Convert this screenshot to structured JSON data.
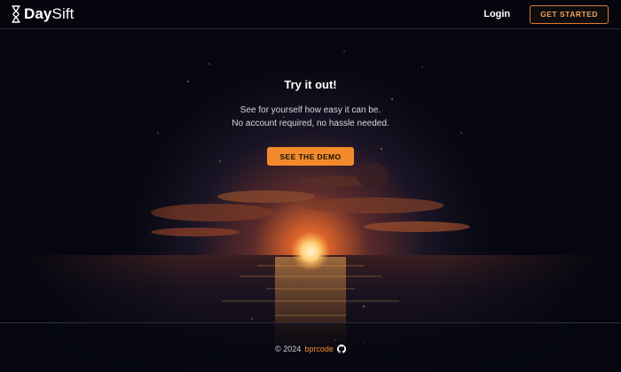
{
  "header": {
    "brand_bold": "Day",
    "brand_thin": "Sift",
    "login_label": "Login",
    "get_started_label": "GET STARTED"
  },
  "hero": {
    "title": "Try it out!",
    "line1": "See for yourself how easy it can be.",
    "line2": "No account required, no hassle needed.",
    "demo_label": "SEE THE DEMO"
  },
  "footer": {
    "copyright": "© 2024",
    "author_link": "bprcode",
    "github_icon": "github-icon"
  },
  "colors": {
    "accent": "#f28a2c",
    "background": "#05060f",
    "divider": "#2a2d3a"
  },
  "background_image": "sunset-over-ocean"
}
